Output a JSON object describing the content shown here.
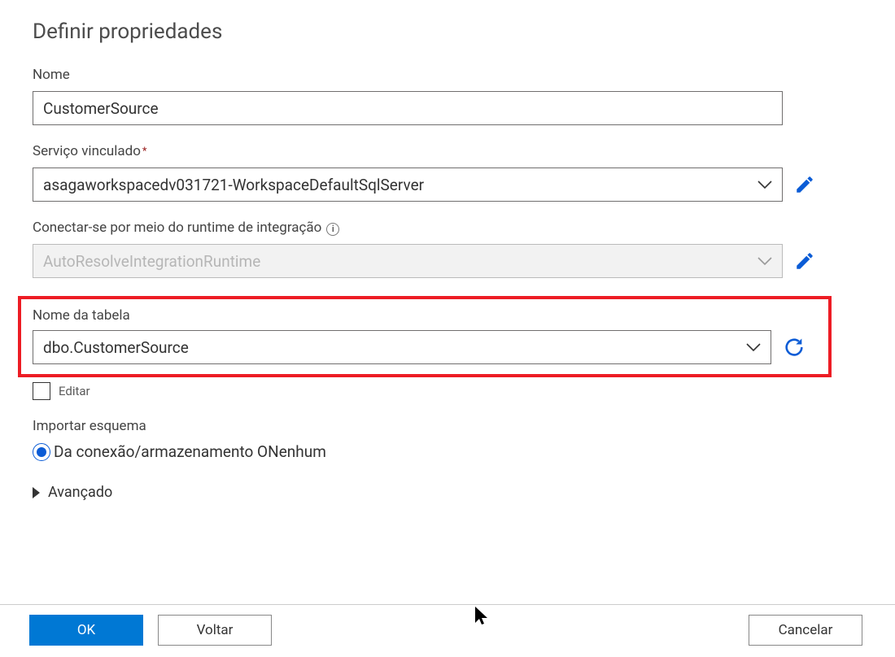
{
  "title": "Definir propriedades",
  "fields": {
    "name": {
      "label": "Nome",
      "value": "CustomerSource"
    },
    "linked_service": {
      "label": "Serviço vinculado",
      "value": "asagaworkspacedv031721-WorkspaceDefaultSqlServer",
      "required": true
    },
    "integration_runtime": {
      "label": "Conectar-se por meio do runtime de integração",
      "value": "AutoResolveIntegrationRuntime"
    },
    "table_name": {
      "label": "Nome da tabela",
      "value": "dbo.CustomerSource"
    },
    "edit_checkbox": {
      "label": "Editar",
      "checked": false
    },
    "import_schema": {
      "label": "Importar esquema",
      "option_combined": "Da conexão/armazenamento ONenhum"
    },
    "advanced": {
      "label": "Avançado"
    }
  },
  "footer": {
    "ok": "OK",
    "back": "Voltar",
    "cancel": "Cancelar"
  },
  "icons": {
    "edit": "pencil-icon",
    "refresh": "refresh-icon",
    "info": "info-icon",
    "chevron": "chevron-down-icon",
    "expand_right": "chevron-right-icon"
  }
}
